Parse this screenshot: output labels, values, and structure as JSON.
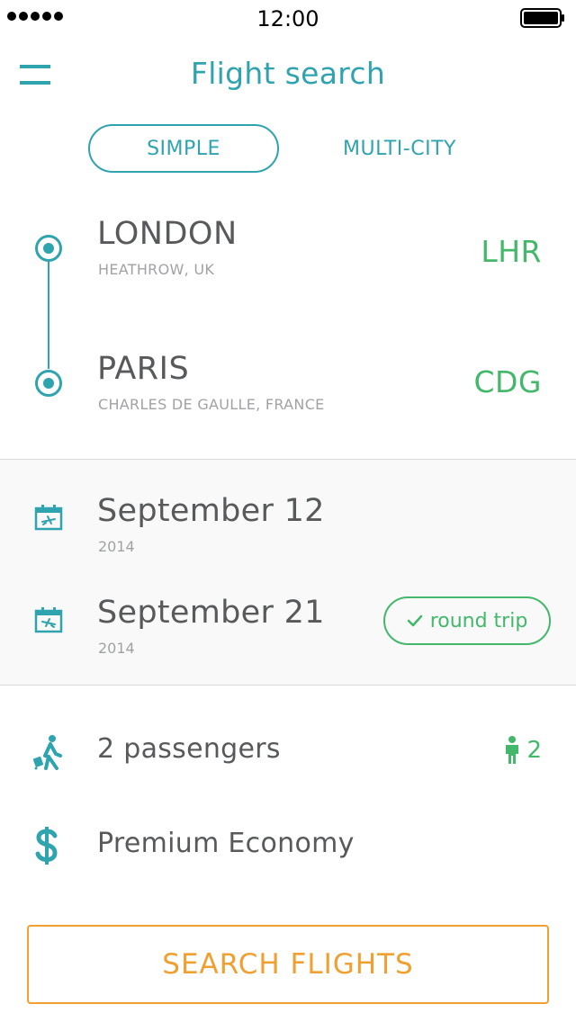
{
  "status": {
    "time": "12:00"
  },
  "header": {
    "title": "Flight search"
  },
  "tabs": [
    {
      "label": "SIMPLE",
      "active": true
    },
    {
      "label": "MULTI-CITY",
      "active": false
    }
  ],
  "route": {
    "origin": {
      "city": "LONDON",
      "airport": "HEATHROW, UK",
      "code": "LHR"
    },
    "destination": {
      "city": "PARIS",
      "airport": "CHARLES DE GAULLE, FRANCE",
      "code": "CDG"
    }
  },
  "dates": {
    "departure": {
      "date": "September 12",
      "year": "2014",
      "icon": "calendar-departure-icon"
    },
    "return": {
      "date": "September 21",
      "year": "2014",
      "icon": "calendar-arrival-icon"
    },
    "round_trip_label": "round trip"
  },
  "passengers": {
    "label": "2 passengers",
    "count": "2",
    "icon": "traveler-icon"
  },
  "cabin": {
    "label": "Premium Economy",
    "icon": "dollar-icon"
  },
  "search_button": {
    "label": "SEARCH FLIGHTS"
  },
  "colors": {
    "teal": "#2fa4af",
    "green": "#43b86a",
    "orange": "#f0a030",
    "text": "#58595b",
    "muted": "#a0a2a4"
  }
}
